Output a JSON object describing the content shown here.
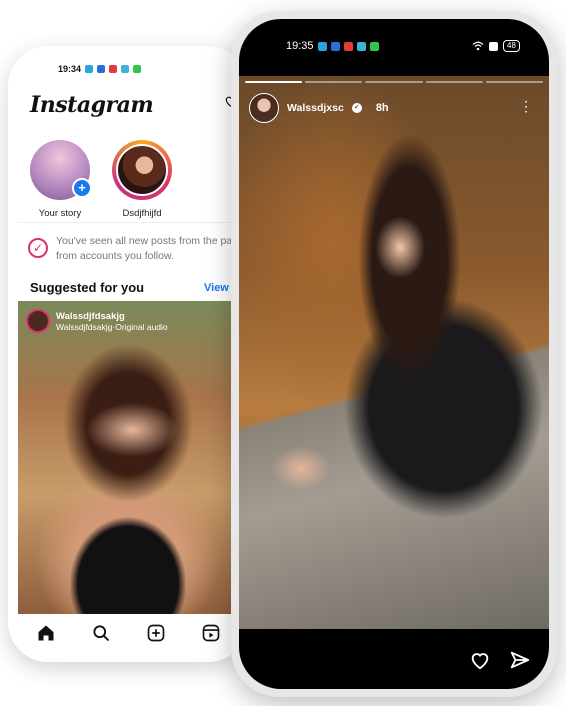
{
  "back_phone": {
    "status_time": "19:34",
    "logo": "Instagram",
    "stories": [
      {
        "label": "Your story"
      },
      {
        "label": "Dsdjfhijfd"
      }
    ],
    "seen_line1": "You've seen all new posts from the pa",
    "seen_line2": "from accounts you follow.",
    "suggested_title": "Suggested for you",
    "view_all": "View a",
    "post": {
      "username": "Walssdjfdsakjg",
      "audio": "Walssdjfdsakjg·Original audio"
    },
    "nav_icons": [
      "home-icon",
      "search-icon",
      "create-icon",
      "reels-icon"
    ]
  },
  "front_phone": {
    "status_time": "19:35",
    "battery": "48",
    "story_user": "Walssdjxsc",
    "story_time": "8h"
  },
  "colors": {
    "brand_pink": "#e1306c",
    "link_blue": "#1877f2"
  }
}
